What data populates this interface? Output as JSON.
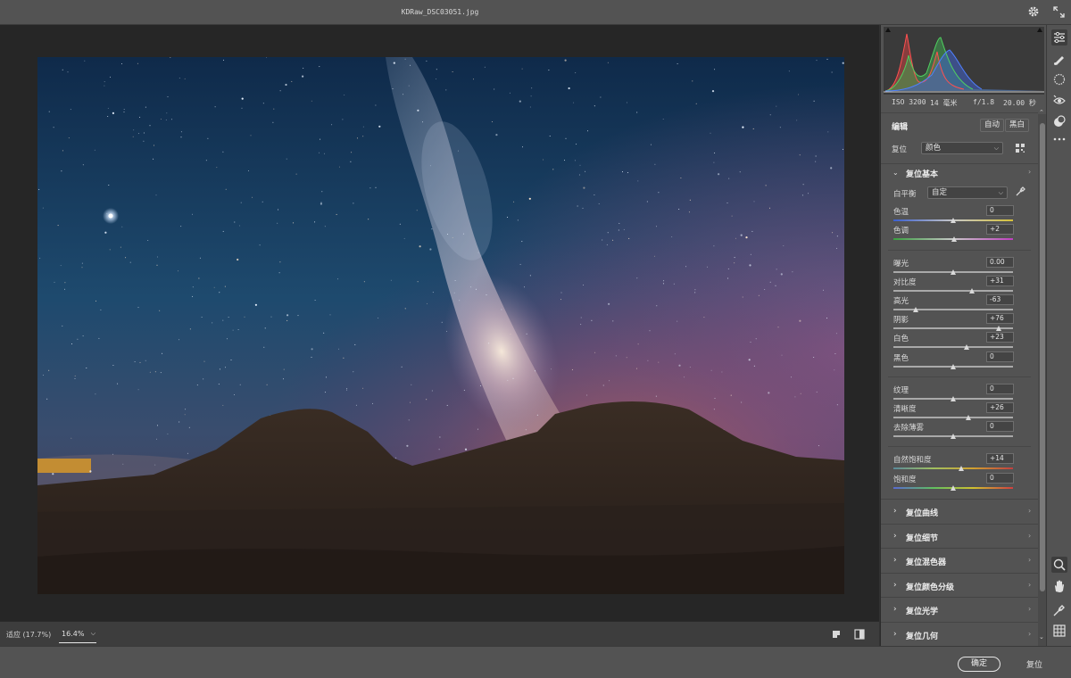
{
  "window": {
    "title": "KDRaw_DSC03051.jpg"
  },
  "icons": {
    "settings": "gear-icon",
    "expand": "expand-icon"
  },
  "exif": {
    "iso": "ISO 3200",
    "focal": "14 毫米",
    "aperture": "f/1.8",
    "shutter": "20.00 秒"
  },
  "edit": {
    "title": "编辑",
    "auto_label": "自动",
    "bw_label": "黑白"
  },
  "profile": {
    "label": "复位",
    "value": "颜色"
  },
  "basic": {
    "title": "复位基本",
    "white_balance": {
      "label": "白平衡",
      "value": "自定"
    },
    "sliders": [
      {
        "label": "色温",
        "value": "0",
        "level": 0.5
      },
      {
        "label": "色调",
        "value": "+2",
        "level": 0.51
      },
      {
        "label": "曝光",
        "value": "0.00",
        "level": 0.5
      },
      {
        "label": "对比度",
        "value": "+31",
        "level": 0.655
      },
      {
        "label": "高光",
        "value": "-63",
        "level": 0.185
      },
      {
        "label": "阴影",
        "value": "+76",
        "level": 0.88
      },
      {
        "label": "白色",
        "value": "+23",
        "level": 0.615
      },
      {
        "label": "黑色",
        "value": "0",
        "level": 0.5
      },
      {
        "label": "纹理",
        "value": "0",
        "level": 0.5
      },
      {
        "label": "清晰度",
        "value": "+26",
        "level": 0.63
      },
      {
        "label": "去除薄雾",
        "value": "0",
        "level": 0.5
      },
      {
        "label": "自然饱和度",
        "value": "+14",
        "level": 0.57
      },
      {
        "label": "饱和度",
        "value": "0",
        "level": 0.5
      }
    ]
  },
  "collapsed_sections": [
    "复位曲线",
    "复位细节",
    "复位混色器",
    "复位颜色分级",
    "复位光学",
    "复位几何"
  ],
  "bottom": {
    "fit_zoom": "适应 (17.7%)",
    "current_zoom": "16.4%"
  },
  "footer": {
    "ok_label": "确定",
    "reset_label": "复位"
  },
  "colors": {
    "panel_bg": "#535353",
    "canvas_bg": "#262626",
    "accent": "#e6e6e6"
  }
}
